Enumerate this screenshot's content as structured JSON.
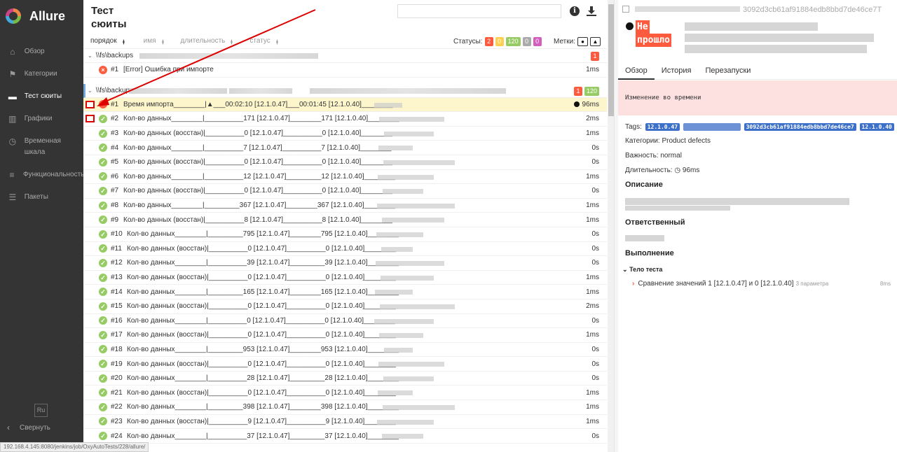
{
  "app": {
    "name": "Allure"
  },
  "sidebar": {
    "items": [
      {
        "label": "Обзор",
        "icon": "home-icon"
      },
      {
        "label": "Категории",
        "icon": "flag-icon"
      },
      {
        "label": "Тест сюиты",
        "icon": "briefcase-icon",
        "active": true
      },
      {
        "label": "Графики",
        "icon": "bar-chart-icon"
      },
      {
        "label": "Временная шкала",
        "icon": "clock-icon"
      },
      {
        "label": "Функциональность",
        "icon": "list-icon"
      },
      {
        "label": "Пакеты",
        "icon": "align-left-icon"
      }
    ],
    "lang": "Ru",
    "collapse_label": "Свернуть"
  },
  "status_url": "192.168.4.145:8080/jenkins/job/OxyAutoTests/228/allure/",
  "suites": {
    "title_line1": "Тест",
    "title_line2": "сюиты",
    "sort": [
      "порядок",
      "имя",
      "длительность",
      "статус"
    ],
    "statuses_label": "Статусы:",
    "status_counts": [
      {
        "value": "2",
        "color": "#fd5a3e"
      },
      {
        "value": "0",
        "color": "#ffd050"
      },
      {
        "value": "120",
        "color": "#97cc64"
      },
      {
        "value": "0",
        "color": "#aaaaaa"
      },
      {
        "value": "0",
        "color": "#d35ebe"
      }
    ],
    "marks_label": "Метки:",
    "group1": {
      "name": "\\\\fs\\backups",
      "fail_count": "1"
    },
    "group1_rows": [
      {
        "num": "#1",
        "name": "[Error] Ошибка при импорте",
        "dur": "1ms",
        "status": "fail"
      }
    ],
    "group2": {
      "name": "\\\\fs\\backup",
      "fail_count": "1",
      "pass_count": "120"
    },
    "group2_rows": [
      {
        "num": "#1",
        "name": "Время импорта________|▲___00:02:10 [12.1.0.47]___00:01:45 [12.1.0.40]________",
        "dur": "96ms",
        "status": "fail",
        "bomb": true
      },
      {
        "num": "#2",
        "name": "Кол-во данных________|__________171 [12.1.0.47]________171 [12.1.0.40]________",
        "dur": "2ms",
        "status": "ok"
      },
      {
        "num": "#3",
        "name": "Кол-во данных (восстан)|__________0 [12.1.0.47]__________0 [12.1.0.40]________",
        "dur": "1ms",
        "status": "ok"
      },
      {
        "num": "#4",
        "name": "Кол-во данных________|__________7 [12.1.0.47]__________7 [12.1.0.40]________",
        "dur": "0s",
        "status": "ok"
      },
      {
        "num": "#5",
        "name": "Кол-во данных (восстан)|__________0 [12.1.0.47]__________0 [12.1.0.40]________",
        "dur": "0s",
        "status": "ok"
      },
      {
        "num": "#6",
        "name": "Кол-во данных________|__________12 [12.1.0.47]_________12 [12.1.0.40]________",
        "dur": "1ms",
        "status": "ok"
      },
      {
        "num": "#7",
        "name": "Кол-во данных (восстан)|__________0 [12.1.0.47]__________0 [12.1.0.40]________",
        "dur": "0s",
        "status": "ok"
      },
      {
        "num": "#8",
        "name": "Кол-во данных________|_________367 [12.1.0.47]________367 [12.1.0.40]________",
        "dur": "1ms",
        "status": "ok"
      },
      {
        "num": "#9",
        "name": "Кол-во данных (восстан)|__________8 [12.1.0.47]__________8 [12.1.0.40]________",
        "dur": "1ms",
        "status": "ok"
      },
      {
        "num": "#10",
        "name": "Кол-во данных________|_________795 [12.1.0.47]________795 [12.1.0.40]________",
        "dur": "0s",
        "status": "ok"
      },
      {
        "num": "#11",
        "name": "Кол-во данных (восстан)|__________0 [12.1.0.47]__________0 [12.1.0.40]________",
        "dur": "0s",
        "status": "ok"
      },
      {
        "num": "#12",
        "name": "Кол-во данных________|__________39 [12.1.0.47]_________39 [12.1.0.40]________",
        "dur": "0s",
        "status": "ok"
      },
      {
        "num": "#13",
        "name": "Кол-во данных (восстан)|__________0 [12.1.0.47]__________0 [12.1.0.40]________",
        "dur": "1ms",
        "status": "ok"
      },
      {
        "num": "#14",
        "name": "Кол-во данных________|_________165 [12.1.0.47]________165 [12.1.0.40]________",
        "dur": "1ms",
        "status": "ok"
      },
      {
        "num": "#15",
        "name": "Кол-во данных (восстан)|__________0 [12.1.0.47]__________0 [12.1.0.40]________",
        "dur": "2ms",
        "status": "ok"
      },
      {
        "num": "#16",
        "name": "Кол-во данных________|__________0 [12.1.0.47]__________0 [12.1.0.40]________",
        "dur": "0s",
        "status": "ok"
      },
      {
        "num": "#17",
        "name": "Кол-во данных (восстан)|__________0 [12.1.0.47]__________0 [12.1.0.40]________",
        "dur": "1ms",
        "status": "ok"
      },
      {
        "num": "#18",
        "name": "Кол-во данных________|_________953 [12.1.0.47]________953 [12.1.0.40]________",
        "dur": "0s",
        "status": "ok"
      },
      {
        "num": "#19",
        "name": "Кол-во данных (восстан)|__________0 [12.1.0.47]__________0 [12.1.0.40]________",
        "dur": "0s",
        "status": "ok"
      },
      {
        "num": "#20",
        "name": "Кол-во данных________|__________28 [12.1.0.47]_________28 [12.1.0.40]________",
        "dur": "0s",
        "status": "ok"
      },
      {
        "num": "#21",
        "name": "Кол-во данных (восстан)|__________0 [12.1.0.47]__________0 [12.1.0.40]________",
        "dur": "1ms",
        "status": "ok"
      },
      {
        "num": "#22",
        "name": "Кол-во данных________|_________398 [12.1.0.47]________398 [12.1.0.40]________",
        "dur": "1ms",
        "status": "ok"
      },
      {
        "num": "#23",
        "name": "Кол-во данных (восстан)|__________9 [12.1.0.47]__________9 [12.1.0.40]________",
        "dur": "1ms",
        "status": "ok"
      },
      {
        "num": "#24",
        "name": "Кол-во данных________|__________37 [12.1.0.47]_________37 [12.1.0.40]________",
        "dur": "0s",
        "status": "ok"
      }
    ]
  },
  "detail": {
    "uid_fragment": "3092d3cb61af91884edb8bbd7de46ce7T",
    "status_line1": "Не",
    "status_line2": "прошло",
    "tabs": [
      "Обзор",
      "История",
      "Перезапуски"
    ],
    "banner": "Изменение во времени",
    "tags_label": "Tags:",
    "tags": [
      "12.1.0.47",
      "3092d3cb61af91884edb8bbd7de46ce7",
      "12.1.0.40"
    ],
    "category": "Категории: Product defects",
    "severity": "Важность: normal",
    "duration_label": "Длительность:",
    "duration": "96ms",
    "description_title": "Описание",
    "owner_title": "Ответственный",
    "execution_title": "Выполнение",
    "body_title": "Тело теста",
    "step_name": "Сравнение значений 1 [12.1.0.47] и 0 [12.1.0.40]",
    "step_params": "3 параметра",
    "step_duration": "8ms"
  }
}
